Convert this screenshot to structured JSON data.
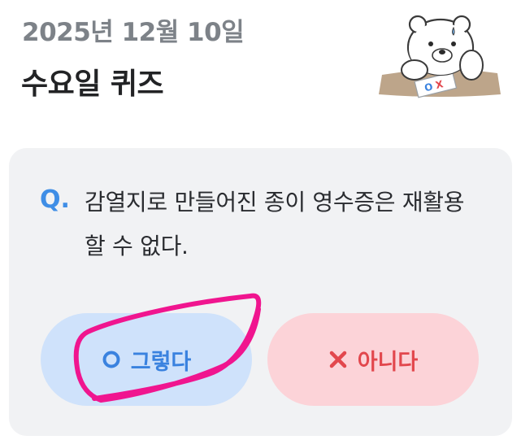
{
  "header": {
    "date": "2025년 12월 10일",
    "title": "수요일 퀴즈"
  },
  "quiz": {
    "q_label": "Q.",
    "question": "감열지로 만들어진 종이 영수증은 재활용할 수 없다.",
    "answers": {
      "yes_label": "그렇다",
      "no_label": "아니다"
    }
  },
  "mascot_sign": {
    "o": "O",
    "x": "X"
  },
  "colors": {
    "accent_blue": "#3a82df",
    "accent_red": "#e2474d",
    "card_bg": "#f1f2f4",
    "annotation_pink": "#f0158f"
  },
  "icons": {
    "yes": "circle-o-icon",
    "no": "x-mark-icon"
  }
}
